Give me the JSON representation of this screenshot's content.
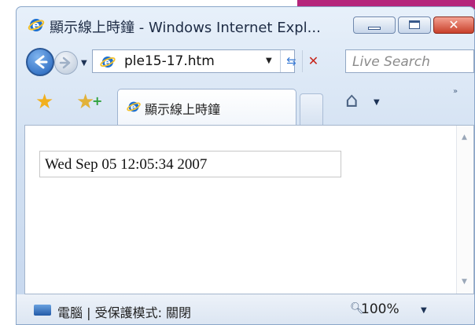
{
  "window": {
    "title": "顯示線上時鐘 - Windows Internet Expl...",
    "close_label": "✕"
  },
  "nav": {
    "address": "ple15-17.htm",
    "search_placeholder": "Live Search"
  },
  "tabs": [
    {
      "label": "顯示線上時鐘"
    }
  ],
  "content": {
    "clock_text": "Wed Sep 05 12:05:34 2007"
  },
  "status": {
    "zone_text": "電腦 | 受保護模式: 關閉",
    "zoom": "100%"
  },
  "icons": [
    "ie-logo-icon",
    "back-arrow-icon",
    "forward-arrow-icon",
    "refresh-icon",
    "stop-icon",
    "favorites-star-icon",
    "add-favorites-icon",
    "home-icon",
    "zoom-magnifier-icon",
    "computer-zone-icon"
  ]
}
